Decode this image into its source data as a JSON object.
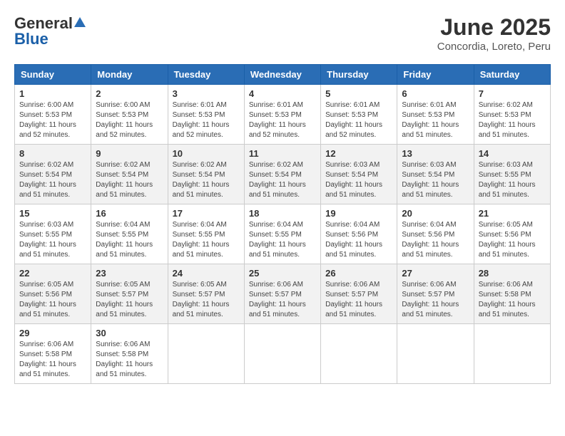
{
  "header": {
    "logo": {
      "general": "General",
      "blue": "Blue"
    },
    "title": "June 2025",
    "location": "Concordia, Loreto, Peru"
  },
  "weekdays": [
    "Sunday",
    "Monday",
    "Tuesday",
    "Wednesday",
    "Thursday",
    "Friday",
    "Saturday"
  ],
  "weeks": [
    [
      {
        "day": "1",
        "sunrise": "6:00 AM",
        "sunset": "5:53 PM",
        "daylight": "11 hours and 52 minutes."
      },
      {
        "day": "2",
        "sunrise": "6:00 AM",
        "sunset": "5:53 PM",
        "daylight": "11 hours and 52 minutes."
      },
      {
        "day": "3",
        "sunrise": "6:01 AM",
        "sunset": "5:53 PM",
        "daylight": "11 hours and 52 minutes."
      },
      {
        "day": "4",
        "sunrise": "6:01 AM",
        "sunset": "5:53 PM",
        "daylight": "11 hours and 52 minutes."
      },
      {
        "day": "5",
        "sunrise": "6:01 AM",
        "sunset": "5:53 PM",
        "daylight": "11 hours and 52 minutes."
      },
      {
        "day": "6",
        "sunrise": "6:01 AM",
        "sunset": "5:53 PM",
        "daylight": "11 hours and 51 minutes."
      },
      {
        "day": "7",
        "sunrise": "6:02 AM",
        "sunset": "5:53 PM",
        "daylight": "11 hours and 51 minutes."
      }
    ],
    [
      {
        "day": "8",
        "sunrise": "6:02 AM",
        "sunset": "5:54 PM",
        "daylight": "11 hours and 51 minutes."
      },
      {
        "day": "9",
        "sunrise": "6:02 AM",
        "sunset": "5:54 PM",
        "daylight": "11 hours and 51 minutes."
      },
      {
        "day": "10",
        "sunrise": "6:02 AM",
        "sunset": "5:54 PM",
        "daylight": "11 hours and 51 minutes."
      },
      {
        "day": "11",
        "sunrise": "6:02 AM",
        "sunset": "5:54 PM",
        "daylight": "11 hours and 51 minutes."
      },
      {
        "day": "12",
        "sunrise": "6:03 AM",
        "sunset": "5:54 PM",
        "daylight": "11 hours and 51 minutes."
      },
      {
        "day": "13",
        "sunrise": "6:03 AM",
        "sunset": "5:54 PM",
        "daylight": "11 hours and 51 minutes."
      },
      {
        "day": "14",
        "sunrise": "6:03 AM",
        "sunset": "5:55 PM",
        "daylight": "11 hours and 51 minutes."
      }
    ],
    [
      {
        "day": "15",
        "sunrise": "6:03 AM",
        "sunset": "5:55 PM",
        "daylight": "11 hours and 51 minutes."
      },
      {
        "day": "16",
        "sunrise": "6:04 AM",
        "sunset": "5:55 PM",
        "daylight": "11 hours and 51 minutes."
      },
      {
        "day": "17",
        "sunrise": "6:04 AM",
        "sunset": "5:55 PM",
        "daylight": "11 hours and 51 minutes."
      },
      {
        "day": "18",
        "sunrise": "6:04 AM",
        "sunset": "5:55 PM",
        "daylight": "11 hours and 51 minutes."
      },
      {
        "day": "19",
        "sunrise": "6:04 AM",
        "sunset": "5:56 PM",
        "daylight": "11 hours and 51 minutes."
      },
      {
        "day": "20",
        "sunrise": "6:04 AM",
        "sunset": "5:56 PM",
        "daylight": "11 hours and 51 minutes."
      },
      {
        "day": "21",
        "sunrise": "6:05 AM",
        "sunset": "5:56 PM",
        "daylight": "11 hours and 51 minutes."
      }
    ],
    [
      {
        "day": "22",
        "sunrise": "6:05 AM",
        "sunset": "5:56 PM",
        "daylight": "11 hours and 51 minutes."
      },
      {
        "day": "23",
        "sunrise": "6:05 AM",
        "sunset": "5:57 PM",
        "daylight": "11 hours and 51 minutes."
      },
      {
        "day": "24",
        "sunrise": "6:05 AM",
        "sunset": "5:57 PM",
        "daylight": "11 hours and 51 minutes."
      },
      {
        "day": "25",
        "sunrise": "6:06 AM",
        "sunset": "5:57 PM",
        "daylight": "11 hours and 51 minutes."
      },
      {
        "day": "26",
        "sunrise": "6:06 AM",
        "sunset": "5:57 PM",
        "daylight": "11 hours and 51 minutes."
      },
      {
        "day": "27",
        "sunrise": "6:06 AM",
        "sunset": "5:57 PM",
        "daylight": "11 hours and 51 minutes."
      },
      {
        "day": "28",
        "sunrise": "6:06 AM",
        "sunset": "5:58 PM",
        "daylight": "11 hours and 51 minutes."
      }
    ],
    [
      {
        "day": "29",
        "sunrise": "6:06 AM",
        "sunset": "5:58 PM",
        "daylight": "11 hours and 51 minutes."
      },
      {
        "day": "30",
        "sunrise": "6:06 AM",
        "sunset": "5:58 PM",
        "daylight": "11 hours and 51 minutes."
      },
      null,
      null,
      null,
      null,
      null
    ]
  ],
  "labels": {
    "sunrise": "Sunrise: ",
    "sunset": "Sunset: ",
    "daylight": "Daylight: "
  }
}
